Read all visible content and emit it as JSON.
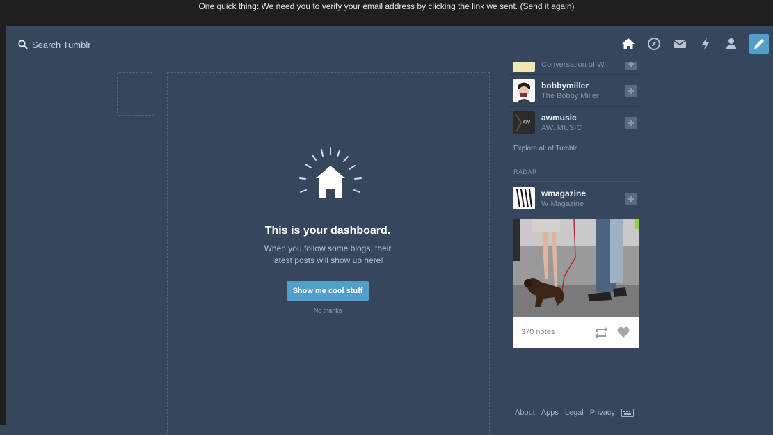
{
  "notice": {
    "text": "One quick thing: We need you to verify your email address by clicking the link we sent. (Send it again)"
  },
  "search": {
    "placeholder": "Search Tumblr"
  },
  "nav": {
    "icons": [
      "home-icon",
      "compass-icon",
      "inbox-icon",
      "lightning-icon",
      "account-icon",
      "compose-icon"
    ]
  },
  "dashboard": {
    "title": "This is your dashboard.",
    "text": "When you follow some blogs, their latest posts will show up here!",
    "cta_label": "Show me cool stuff",
    "no_thanks": "No thanks"
  },
  "sidebar": {
    "top_partial": "Conversation of W...",
    "recommendations": [
      {
        "name": "bobbymiller",
        "sub": "The Bobby Miller"
      },
      {
        "name": "awmusic",
        "sub": "AW. MUSIC"
      }
    ],
    "explore_label": "Explore all of Tumblr",
    "radar_title": "RADAR",
    "radar": {
      "name": "wmagazine",
      "sub": "W Magazine",
      "notes": "370 notes"
    }
  },
  "footer": {
    "links": [
      "About",
      "Apps",
      "Legal",
      "Privacy"
    ]
  },
  "colors": {
    "background": "#36465d",
    "accent": "#529ecc",
    "notice_bar": "#1f1f1f"
  }
}
